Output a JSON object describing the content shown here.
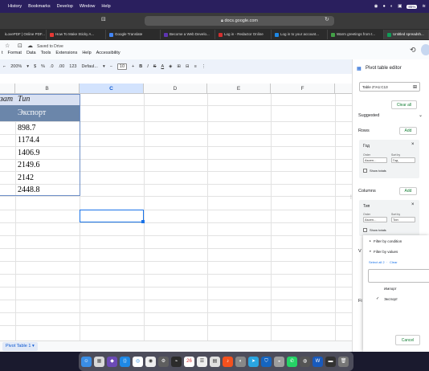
{
  "menubar": {
    "items": [
      "History",
      "Bookmarks",
      "Develop",
      "Window",
      "Help"
    ],
    "battery": "85%"
  },
  "browser": {
    "url": "docs.google.com",
    "tabs": [
      {
        "label": "iLovePDF | Online PDF...",
        "color": "#e53935"
      },
      {
        "label": "How To Make Sticky A...",
        "color": "#e53935"
      },
      {
        "label": "Google Translate",
        "color": "#4285f4"
      },
      {
        "label": "Become a Web Develo...",
        "color": "#5e35b1"
      },
      {
        "label": "Log in - Redactor Online",
        "color": "#d32f2f"
      },
      {
        "label": "Log in to your account...",
        "color": "#1e88e5"
      },
      {
        "label": "Warm greetings from t...",
        "color": "#43a047"
      },
      {
        "label": "Untitled spreadsh...",
        "color": "#0f9d58",
        "active": true
      }
    ]
  },
  "doc": {
    "saved": "Saved to Drive",
    "menu": [
      "t",
      "Format",
      "Data",
      "Tools",
      "Extensions",
      "Help",
      "Accessibility"
    ]
  },
  "toolbar": {
    "zoom": "200%",
    "currency": "$",
    "percent": "%",
    "font": "Defaul...",
    "font_size": "10",
    "bold": "B",
    "italic": "I",
    "strike": "S"
  },
  "grid": {
    "columns": [
      "B",
      "C",
      "D",
      "E",
      "F"
    ],
    "header_left": "зат",
    "header_type": "Тип",
    "export_label": "Экспорт",
    "values": [
      "898.7",
      "1174.4",
      "1406.9",
      "2149.6",
      "2142",
      "2448.8"
    ]
  },
  "sheet_tab": "Pivot Table 1",
  "panel": {
    "title": "Pivot table editor",
    "range": "Table 2'!A1:C13",
    "clear_all": "Clear all",
    "suggested": "Suggested",
    "rows_label": "Rows",
    "columns_label": "Columns",
    "add": "Add",
    "row_field": {
      "name": "Год",
      "order_label": "Order",
      "order_val": "Ascen...",
      "sortby_label": "Sort by",
      "sortby_val": "Год",
      "show_totals": "Show totals"
    },
    "col_field": {
      "name": "Тип",
      "order_label": "Order",
      "order_val": "Ascen...",
      "sortby_label": "Sort by",
      "sortby_val": "Тип",
      "show_totals": "Show totals"
    },
    "values_letter": "V",
    "filters_letter": "Fi"
  },
  "filter": {
    "by_condition": "Filter by condition",
    "by_values": "Filter by values",
    "select_all": "Select all 2",
    "clear": "Clear",
    "options": [
      {
        "label": "Импорт",
        "checked": false
      },
      {
        "label": "Экспорт",
        "checked": true
      }
    ],
    "cancel": "Cancel"
  }
}
